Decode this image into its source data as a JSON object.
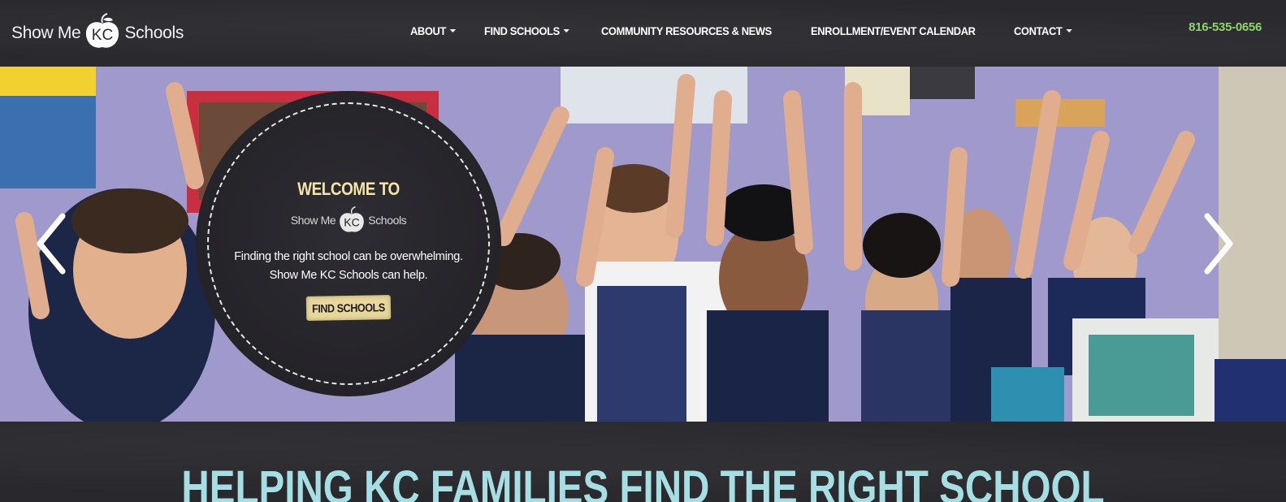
{
  "header": {
    "logo": {
      "text_left": "Show Me",
      "text_mid": "KC",
      "text_right": "Schools"
    },
    "nav": [
      {
        "label": "ABOUT",
        "dropdown": true
      },
      {
        "label": "FIND SCHOOLS",
        "dropdown": true
      },
      {
        "label": "COMMUNITY RESOURCES & NEWS",
        "dropdown": false
      },
      {
        "label": "ENROLLMENT/EVENT CALENDAR",
        "dropdown": false
      },
      {
        "label": "CONTACT",
        "dropdown": true
      }
    ],
    "phone": "816-535-0656"
  },
  "hero": {
    "welcome": "WELCOME TO",
    "logo": {
      "text_left": "Show Me",
      "text_mid": "KC",
      "text_right": "Schools"
    },
    "tagline_line1": "Finding the right school can be overwhelming.",
    "tagline_line2": "Show Me KC Schools can help.",
    "cta_label": "FIND SCHOOLS",
    "prev_icon": "chevron-left-icon",
    "next_icon": "chevron-right-icon"
  },
  "main": {
    "headline": "HELPING KC FAMILIES FIND THE RIGHT SCHOOL"
  },
  "colors": {
    "header_bg": "#2a292d",
    "phone": "#8fd46b",
    "welcome": "#f6e4a4",
    "cta_bg": "#e8d89c",
    "headline": "#a5dfe4"
  }
}
